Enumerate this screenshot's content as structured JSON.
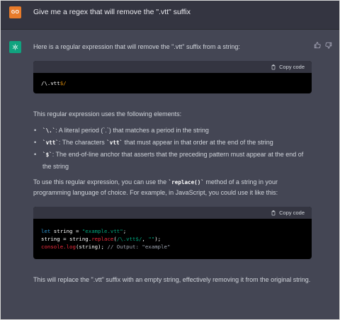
{
  "user": {
    "avatar_initials": "GO",
    "message": "Give me a regex that will remove the \".vtt\" suffix"
  },
  "assistant": {
    "intro": "Here is a regular expression that will remove the \".vtt\" suffix from a string:",
    "copy_label": "Copy code",
    "code1": {
      "prefix": "/\\.vtt",
      "suffix": "$/"
    },
    "elements_intro": "This regular expression uses the following elements:",
    "bullets": [
      {
        "code": "`\\.`",
        "text": ": A literal period (`.`) that matches a period in the string",
        "code2": ""
      },
      {
        "code": "`vtt`",
        "text": ": The characters ",
        "code2": "`vtt`",
        "text2": " that must appear in that order at the end of the string"
      },
      {
        "code": "`$`",
        "text": ": The end-of-line anchor that asserts that the preceding pattern must appear at the end of the string",
        "code2": ""
      }
    ],
    "usage_before": "To use this regular expression, you can use the ",
    "usage_code": "`replace()`",
    "usage_after": " method of a string in your programming language of choice. For example, in JavaScript, you could use it like this:",
    "code2": {
      "line1_kw": "let",
      "line1_var": " string = ",
      "line1_str": "\"example.vtt\"",
      "line1_end": ";",
      "line2_a": "string = string.",
      "line2_fn": "replace",
      "line2_b": "(",
      "line2_re": "/\\.vtt$/",
      "line2_c": ", ",
      "line2_str": "\"\"",
      "line2_end": ");",
      "line3_fn": "console.log",
      "line3_a": "(string); ",
      "line3_cm": "// Output: \"example\""
    },
    "closing": "This will replace the \".vtt\" suffix with an empty string, effectively removing it from the original string."
  },
  "icons": {
    "thumbs_up": "thumbs-up-icon",
    "thumbs_down": "thumbs-down-icon",
    "copy": "clipboard-icon",
    "bot": "openai-logo-icon"
  },
  "colors": {
    "background": "#444654",
    "user_row": "#343541",
    "user_avatar": "#e87b2a",
    "bot_avatar": "#10a37f",
    "code_bg": "#000000"
  }
}
